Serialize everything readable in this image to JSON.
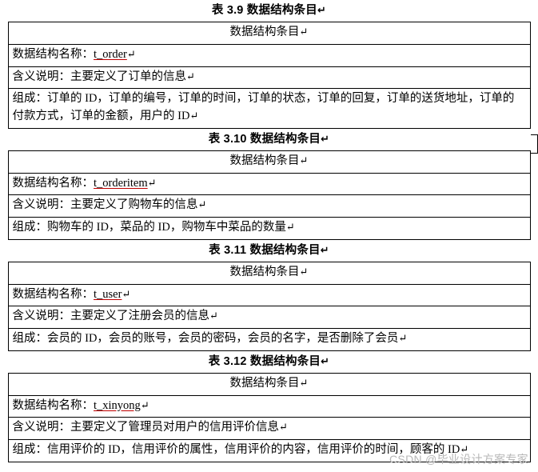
{
  "document": {
    "tables": [
      {
        "caption": "表 3.9 数据结构条目",
        "header": "数据结构条目",
        "rows": [
          {
            "label": "数据结构名称：",
            "value": "t_order",
            "value_style": "underline"
          },
          {
            "label": "含义说明：主要定义了订单的信息",
            "value": "",
            "value_style": "plain"
          },
          {
            "label": "组成：订单的 ID，订单的编号，订单的时间，订单的状态，订单的回复，订单的送货地址，订单的付款方式，订单的金额，用户的 ID",
            "value": "",
            "value_style": "plain"
          }
        ]
      },
      {
        "caption": "表 3.10 数据结构条目",
        "header": "数据结构条目",
        "rows": [
          {
            "label": "数据结构名称：",
            "value": "t_orderitem",
            "value_style": "underline"
          },
          {
            "label": "含义说明：主要定义了购物车的信息",
            "value": "",
            "value_style": "plain"
          },
          {
            "label": "组成：购物车的 ID，菜品的 ID，购物车中菜品的数量",
            "value": "",
            "value_style": "plain"
          }
        ]
      },
      {
        "caption": "表 3.11 数据结构条目",
        "header": "数据结构条目",
        "rows": [
          {
            "label": "数据结构名称：",
            "value": "t_user",
            "value_style": "underline"
          },
          {
            "label": "含义说明：主要定义了注册会员的信息",
            "value": "",
            "value_style": "plain"
          },
          {
            "label": "组成：会员的 ID，会员的账号，会员的密码，会员的名字，是否删除了会员",
            "value": "",
            "value_style": "plain"
          }
        ]
      },
      {
        "caption": "表 3.12 数据结构条目",
        "header": "数据结构条目",
        "rows": [
          {
            "label": "数据结构名称：",
            "value": "t_xinyong",
            "value_style": "underline"
          },
          {
            "label": "含义说明：主要定义了管理员对用户的信用评价信息",
            "value": "",
            "value_style": "plain"
          },
          {
            "label": "组成：信用评价的 ID，信用评价的属性，信用评价的内容，信用评价的时间，顾客的 ID",
            "value": "",
            "value_style": "plain"
          }
        ]
      }
    ],
    "paragraph_mark": "↵",
    "watermark": "CSDN @毕业设计方案专家"
  }
}
